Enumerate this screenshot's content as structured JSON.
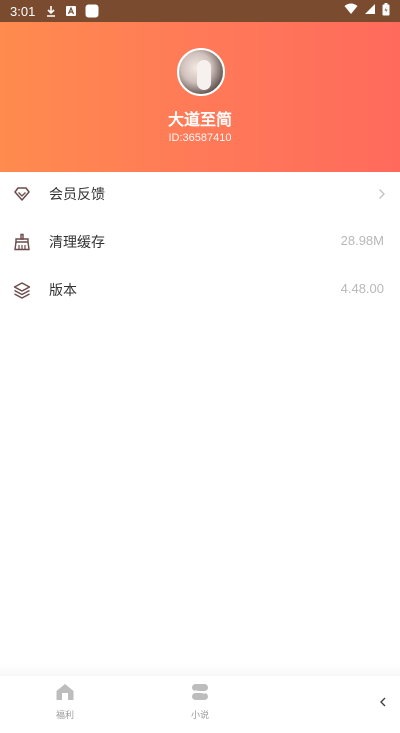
{
  "status_bar": {
    "time": "3:01",
    "icons": [
      "download-icon",
      "text-badge-icon",
      "square-app-icon",
      "wifi-icon",
      "signal-icon",
      "battery-icon"
    ]
  },
  "profile": {
    "nickname": "大道至简",
    "id_text": "ID:36587410",
    "avatar": "avatar-photo"
  },
  "menu": {
    "items": [
      {
        "label": "会员反馈",
        "icon": "diamond-icon",
        "value": "",
        "has_chevron": true
      },
      {
        "label": "清理缓存",
        "icon": "broom-icon",
        "value": "28.98M",
        "has_chevron": false
      },
      {
        "label": "版本",
        "icon": "layers-icon",
        "value": "4.48.00",
        "has_chevron": false
      }
    ]
  },
  "tabbar": {
    "tabs": [
      {
        "label": "福利",
        "icon": "home-icon"
      },
      {
        "label": "小说",
        "icon": "book-icon"
      }
    ],
    "back_icon": "chevron-left-icon"
  },
  "colors": {
    "header_gradient_start": "#ff8b4e",
    "header_gradient_end": "#ff6a5c",
    "status_bar_bg": "#7a4b2e",
    "label_text": "#333333",
    "value_text": "#b8b8b8",
    "icon_stroke": "#6b4b4b",
    "tab_icon": "#bdbdbd"
  }
}
